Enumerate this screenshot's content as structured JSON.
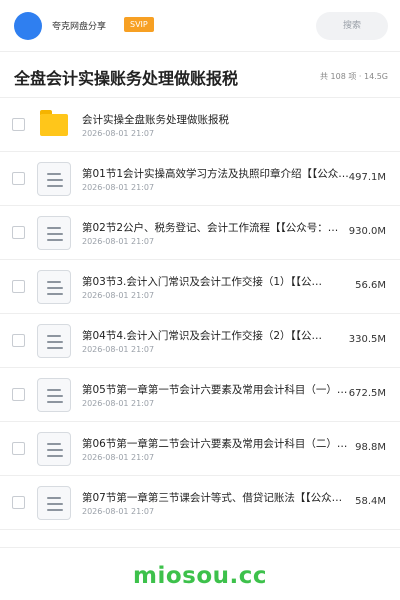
{
  "header": {
    "brand": "夸克网盘分享",
    "badge": "SVIP",
    "search_placeholder": "搜索"
  },
  "page": {
    "title": "全盘会计实操账务处理做账报税",
    "summary": "共 108 项 · 14.5G"
  },
  "files": [
    {
      "name": "会计实操全盘账务处理做账报税",
      "date": "2026-08-01 21:07",
      "size": "",
      "type": "folder"
    },
    {
      "name": "第01节1会计实操高效学习方法及执照印章介绍【【公众号：…",
      "date": "2026-08-01 21:07",
      "size": "497.1M",
      "type": "file"
    },
    {
      "name": "第02节2公户、税务登记、会计工作流程【【公众号：…",
      "date": "2026-08-01 21:07",
      "size": "930.0M",
      "type": "file"
    },
    {
      "name": "第03节3.会计入门常识及会计工作交接（1）【【公…",
      "date": "2026-08-01 21:07",
      "size": "56.6M",
      "type": "file"
    },
    {
      "name": "第04节4.会计入门常识及会计工作交接（2）【【公…",
      "date": "2026-08-01 21:07",
      "size": "330.5M",
      "type": "file"
    },
    {
      "name": "第05节第一章第一节会计六要素及常用会计科目（一）…",
      "date": "2026-08-01 21:07",
      "size": "672.5M",
      "type": "file"
    },
    {
      "name": "第06节第一章第二节会计六要素及常用会计科目（二）…",
      "date": "2026-08-01 21:07",
      "size": "98.8M",
      "type": "file"
    },
    {
      "name": "第07节第一章第三节课会计等式、借贷记账法【【公众…",
      "date": "2026-08-01 21:07",
      "size": "58.4M",
      "type": "file"
    }
  ],
  "watermark": "miosou.cc",
  "colors": {
    "accent": "#2f7ff0",
    "badge": "#f7a023",
    "folder": "#ffc61a",
    "watermark": "#3dc14b"
  }
}
